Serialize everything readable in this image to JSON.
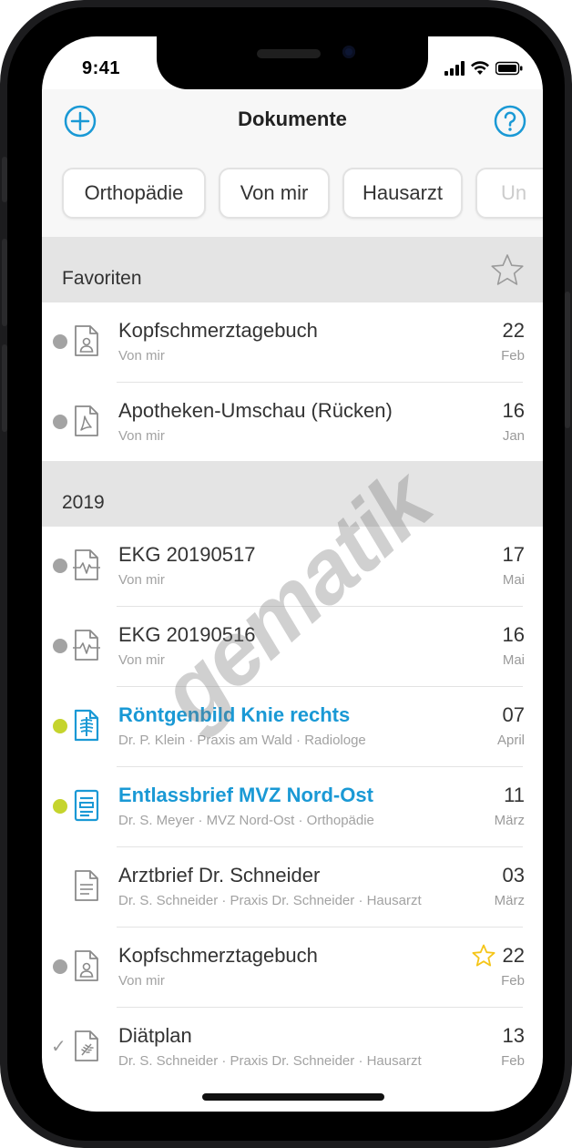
{
  "status_bar": {
    "time": "9:41"
  },
  "nav": {
    "title": "Dokumente",
    "add_icon": "plus-circle-icon",
    "help_icon": "question-circle-icon",
    "accent": "#1a99d5"
  },
  "filters": [
    "Orthopädie",
    "Von mir",
    "Hausarzt",
    "Un"
  ],
  "sections": {
    "favorites": {
      "title": "Favoriten",
      "star_icon": "star-outline-icon"
    },
    "year": {
      "title": "2019"
    }
  },
  "documents": [
    {
      "title": "Kopfschmerztagebuch",
      "subtitle": "Von mir",
      "day": "22",
      "month": "Feb",
      "icon": "diary-doc-icon",
      "marker": "dot"
    },
    {
      "title": "Apotheken-Umschau (Rücken)",
      "subtitle": "Von mir",
      "day": "16",
      "month": "Jan",
      "icon": "pdf-doc-icon",
      "marker": "dot"
    },
    {
      "title": "EKG 20190517",
      "subtitle": "Von mir",
      "day": "17",
      "month": "Mai",
      "icon": "ecg-doc-icon",
      "marker": "dot"
    },
    {
      "title": "EKG 20190516",
      "subtitle": "Von mir",
      "day": "16",
      "month": "Mai",
      "icon": "ecg-doc-icon",
      "marker": "dot"
    },
    {
      "title": "Röntgenbild Knie rechts",
      "subtitle": "Dr. P. Klein · Praxis am Wald · Radiologe",
      "day": "07",
      "month": "April",
      "icon": "xray-doc-icon",
      "marker": "new",
      "highlight": true
    },
    {
      "title": "Entlassbrief MVZ Nord-Ost",
      "subtitle": "Dr. S. Meyer · MVZ Nord-Ost · Orthopädie",
      "day": "11",
      "month": "März",
      "icon": "letter-doc-icon",
      "marker": "new",
      "highlight": true
    },
    {
      "title": "Arztbrief Dr. Schneider",
      "subtitle": "Dr. S. Schneider · Praxis Dr. Schneider · Hausarzt",
      "day": "03",
      "month": "März",
      "icon": "text-doc-icon",
      "marker": "none"
    },
    {
      "title": "Kopfschmerztagebuch",
      "subtitle": "Von mir",
      "day": "22",
      "month": "Feb",
      "icon": "diary-doc-icon",
      "marker": "dot",
      "favorite": true
    },
    {
      "title": "Diätplan",
      "subtitle": "Dr. S. Schneider · Praxis Dr. Schneider · Hausarzt",
      "day": "13",
      "month": "Feb",
      "icon": "diet-doc-icon",
      "marker": "check"
    }
  ],
  "watermark": "gematik",
  "colors": {
    "new_marker": "#c5d42d",
    "read_marker": "#a3a3a3",
    "favorite_star": "#f5c518"
  }
}
